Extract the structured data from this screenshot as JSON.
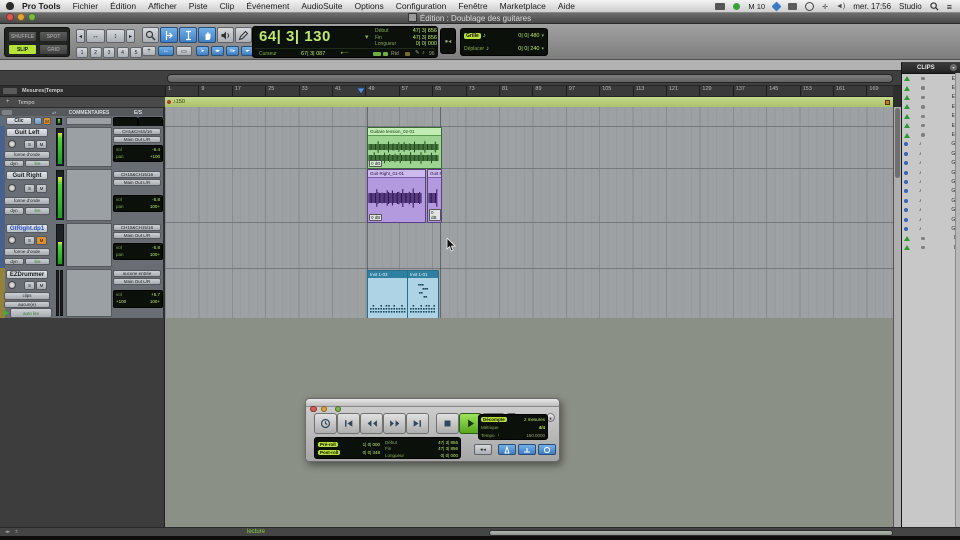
{
  "menubar": {
    "app_menu": "Pro Tools",
    "items": [
      "Fichier",
      "Édition",
      "Afficher",
      "Piste",
      "Clip",
      "Événement",
      "AudioSuite",
      "Options",
      "Configuration",
      "Fenêtre",
      "Marketplace",
      "Aide"
    ],
    "status": {
      "midi_label": "M 10",
      "time": "mer. 17:56",
      "user": "Studio"
    }
  },
  "window_title": "Édition : Doublage des guitares",
  "toolbar": {
    "modes": {
      "shuffle": "SHUFFLE",
      "spot": "SPOT",
      "slip": "SLIP",
      "grid": "GRID"
    },
    "zoom_presets": [
      "1",
      "2",
      "3",
      "4",
      "5"
    ],
    "counter": {
      "main": "64| 3| 130",
      "rows": [
        {
          "label": "Début",
          "value": "47| 3| 856"
        },
        {
          "label": "Fin",
          "value": "47| 3| 856"
        },
        {
          "label": "Longueur",
          "value": "0| 0| 000"
        }
      ],
      "cursor_label": "Curseur",
      "cursor_value": "67| 3| 087",
      "status_text": "Rtd",
      "extra_value": "96"
    },
    "grid_nudge": {
      "grille_label": "Grille",
      "grille_value": "0| 0| 480",
      "deplacer_label": "Déplacer",
      "deplacer_value": "0| 0| 240"
    }
  },
  "ruler": {
    "header": "Mesures|Temps",
    "tempo_row": "Tempo",
    "ticks": [
      "1",
      "9",
      "17",
      "25",
      "33",
      "41",
      "49",
      "57",
      "65",
      "73",
      "81",
      "89",
      "97",
      "105",
      "113",
      "121",
      "129",
      "137",
      "145",
      "153",
      "161",
      "169"
    ],
    "tempo_marker": "150"
  },
  "track_list": {
    "comments_header": "COMMENTAIRES",
    "io_header": "E/S",
    "tracks": [
      {
        "name": "Clic",
        "mute": "M"
      },
      {
        "name": "Guit Left",
        "solo": "S",
        "mute": "M",
        "view": "forme d'onde",
        "automation": "dyn",
        "mode": "lire",
        "input": "CH1&CH15/16",
        "output": "Main Out L/R",
        "vol_label": "vol",
        "vol": "-6.4",
        "pan_label": "pan",
        "pan": "+100"
      },
      {
        "name": "Guit Right",
        "solo": "S",
        "mute": "M",
        "view": "forme d'onde",
        "automation": "dyn",
        "mode": "lire",
        "input": "CH15&CH15/16",
        "output": "Main Out L/R",
        "vol_label": "vol",
        "vol": "-5.8",
        "pan_label": "pan",
        "pan": "100+"
      },
      {
        "name": "GtRight.dp1",
        "solo": "S",
        "mute": "M",
        "view": "forme d'onde",
        "automation": "dyn",
        "mode": "lire",
        "input": "CH15&CH15/16",
        "output": "Main Out L/R",
        "vol_label": "vol",
        "vol": "-5.8",
        "pan_label": "pan",
        "pan": "100+"
      },
      {
        "name": "EZDrummer",
        "solo": "S",
        "mute": "M",
        "view": "clips",
        "automation": "aucun(e)",
        "mode": "auto lire",
        "input": "aucune entrée",
        "output": "Main Out L/R",
        "vol_label": "vol",
        "vol": "+5.7",
        "pan_left": "+100",
        "pan_right": "100+"
      }
    ]
  },
  "clips": {
    "gain": "0 dB",
    "guitar_tension": {
      "label": "Guitare tension_02-01"
    },
    "guit_right_1": {
      "label": "Guit Right_01-01"
    },
    "guit_right_2": {
      "label": "Guit Ri"
    },
    "inst_1": {
      "label": "Inst 1-03"
    },
    "inst_2": {
      "label": "Inst 1-01"
    }
  },
  "clips_panel": {
    "title": "CLIPS",
    "items": [
      {
        "label": "EZ",
        "kind": "group"
      },
      {
        "label": "EZ",
        "kind": "group"
      },
      {
        "label": "EZ",
        "kind": "group"
      },
      {
        "label": "EZ",
        "kind": "group"
      },
      {
        "label": "EZ",
        "kind": "group"
      },
      {
        "label": "EZ",
        "kind": "group"
      },
      {
        "label": "EZ",
        "kind": "group"
      },
      {
        "label": "Gu",
        "kind": "audio"
      },
      {
        "label": "Gu",
        "kind": "audio"
      },
      {
        "label": "Gu",
        "kind": "audio"
      },
      {
        "label": "Gu",
        "kind": "audio"
      },
      {
        "label": "Gu",
        "kind": "audio"
      },
      {
        "label": "Gu",
        "kind": "audio"
      },
      {
        "label": "Gu",
        "kind": "audio"
      },
      {
        "label": "Gu",
        "kind": "audio"
      },
      {
        "label": "Gu",
        "kind": "audio"
      },
      {
        "label": "Gu",
        "kind": "audio"
      },
      {
        "label": "In",
        "kind": "group"
      },
      {
        "label": "In",
        "kind": "group"
      }
    ]
  },
  "transport": {
    "counts": {
      "decompte_label": "Décompte",
      "decompte_value": "2 mesures",
      "metrique_label": "Métrique",
      "metrique_value": "4/4",
      "tempo_label": "Tempo",
      "tempo_value": "150.0000"
    },
    "rolls": {
      "pre_label": "Pré-roll",
      "pre_value": "1| 0| 000",
      "post_label": "Post-roll",
      "post_value": "0| 0| 348"
    },
    "selection": [
      {
        "label": "Début",
        "value": "47| 3| 856"
      },
      {
        "label": "Fin",
        "value": "47| 3| 856"
      },
      {
        "label": "Longueur",
        "value": "0| 0| 000"
      }
    ]
  },
  "status_bar": {
    "mode": "lecture"
  },
  "colors": {
    "accent_green": "#b6e335",
    "lcd_green": "#bde76e",
    "tool_blue": "#3f7ec2",
    "clip_green": "#9dd492",
    "clip_purple": "#b39ade",
    "clip_midi": "#aed3e4"
  }
}
